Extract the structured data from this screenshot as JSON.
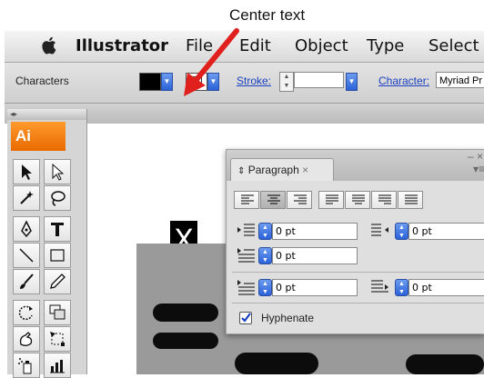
{
  "annotation": {
    "callout": "Center text"
  },
  "menubar": {
    "app_name": "Illustrator",
    "items": [
      "File",
      "Edit",
      "Object",
      "Type",
      "Select"
    ]
  },
  "control_bar": {
    "label": "Characters",
    "stroke_label": "Stroke:",
    "character_label": "Character:",
    "font_value": "Myriad Pr"
  },
  "toolbox": {
    "logo": "Ai"
  },
  "canvas": {
    "glyph": "X"
  },
  "paragraph_panel": {
    "tab_label": "Paragraph",
    "tab_close": "×",
    "fields": {
      "left_indent": "0 pt",
      "right_indent": "0 pt",
      "first_line_indent": "0 pt",
      "space_before": "0 pt",
      "space_after": "0 pt"
    },
    "hyphenate_label": "Hyphenate",
    "hyphenate_checked": true
  },
  "colors": {
    "arrow": "#e0201c",
    "accent_blue": "#2a62d8",
    "ai_orange": "#f07d10"
  }
}
